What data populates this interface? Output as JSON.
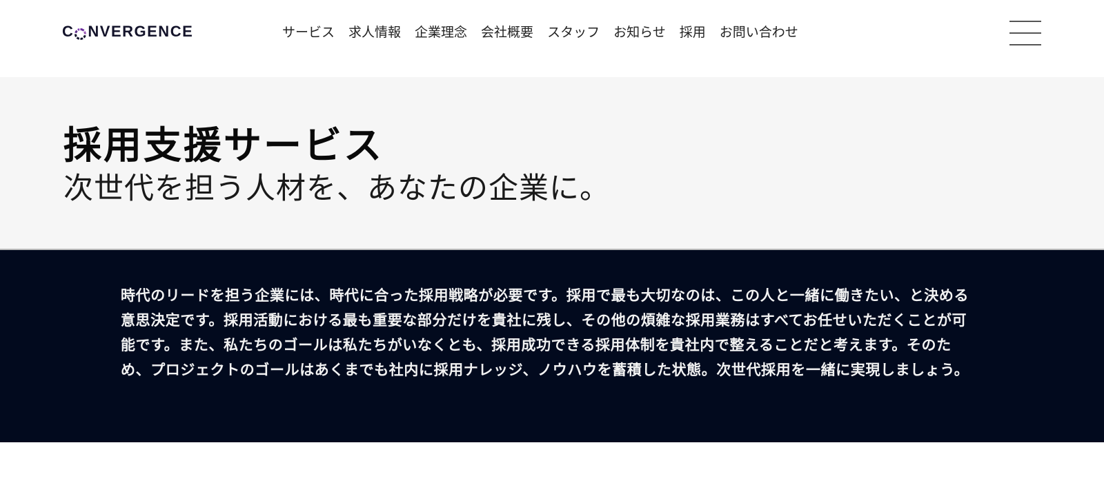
{
  "header": {
    "logo": {
      "prefix": "C",
      "suffix": "NVERGENCE",
      "mark_icon": "dashed-ring-icon",
      "mark_colors": [
        "#5b2a86",
        "#8e44ad",
        "#14142b"
      ]
    },
    "nav": [
      {
        "label": "サービス"
      },
      {
        "label": "求人情報"
      },
      {
        "label": "企業理念"
      },
      {
        "label": "会社概要"
      },
      {
        "label": "スタッフ"
      },
      {
        "label": "お知らせ"
      },
      {
        "label": "採用"
      },
      {
        "label": "お問い合わせ"
      }
    ],
    "menu_icon": "hamburger-menu-icon"
  },
  "hero": {
    "title": "採用支援サービス",
    "subtitle": "次世代を担う人材を、あなたの企業に。"
  },
  "intro": {
    "text": "時代のリードを担う企業には、時代に合った採用戦略が必要です。採用で最も大切なのは、この人と一緒に働きたい、と決める意思決定です。採用活動における最も重要な部分だけを貴社に残し、その他の煩雑な採用業務はすべてお任せいただくことが可能です。また、私たちのゴールは私たちがいなくとも、採用成功できる採用体制を貴社内で整えることだと考えます。そのため、プロジェクトのゴールはあくまでも社内に採用ナレッジ、ノウハウを蓄積した状態。次世代採用を一緒に実現しましょう。"
  },
  "colors": {
    "hero_bg": "#f6f6f6",
    "intro_bg": "#020a1e",
    "intro_text": "#f2f2f2",
    "logo_accent": "#8e44ad"
  }
}
